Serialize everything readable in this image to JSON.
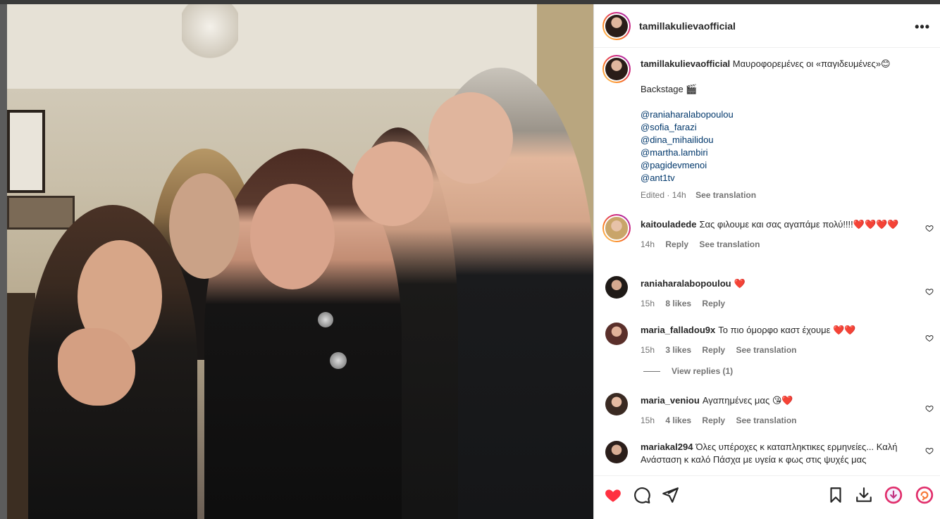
{
  "post": {
    "author": "tamillakulievaofficial",
    "more_label": "•••"
  },
  "caption": {
    "author": "tamillakulievaofficial",
    "text": "Μαυροφορεμένες οι «παγιδευμένες»😊",
    "line2": "Backstage 🎬",
    "mentions": [
      "@raniaharalabopoulou",
      "@sofia_farazi",
      "@dina_mihailidou",
      "@martha.lambiri",
      "@pagidevmenoi",
      "@ant1tv"
    ],
    "time": "Edited · 14h",
    "translate": "See translation"
  },
  "comments": [
    {
      "user": "kaitouladede",
      "text": "Σας φιλουμε και σας αγαπάμε πολύ!!!!❤️❤️❤️❤️",
      "time": "14h",
      "likes": "",
      "reply": "Reply",
      "translate": "See translation"
    },
    {
      "user": "raniaharalabopoulou",
      "text": "❤️",
      "time": "15h",
      "likes": "8 likes",
      "reply": "Reply",
      "translate": ""
    },
    {
      "user": "maria_falladou9x",
      "text": "Το πιο όμορφο καστ έχουμε ❤️❤️",
      "time": "15h",
      "likes": "3 likes",
      "reply": "Reply",
      "translate": "See translation"
    },
    {
      "user": "maria_veniou",
      "text": "Αγαπημένες μας 😘❤️",
      "time": "15h",
      "likes": "4 likes",
      "reply": "Reply",
      "translate": "See translation"
    },
    {
      "user": "mariakal294",
      "text": "Όλες υπέροχες κ καταπληκτικες ερμηνείες... Καλή Ανάσταση κ καλό Πάσχα με υγεία κ φως στις ψυχές μας",
      "time": "",
      "likes": "",
      "reply": "",
      "translate": ""
    }
  ],
  "view_replies": "View replies (1)",
  "colors": {
    "like_red": "#ff3040",
    "link_blue": "#00376b",
    "meta_gray": "#737373"
  },
  "icons": [
    "heart-icon",
    "comment-icon",
    "share-icon",
    "bookmark-icon",
    "download-icon",
    "download-circle-icon",
    "rotate-icon"
  ]
}
